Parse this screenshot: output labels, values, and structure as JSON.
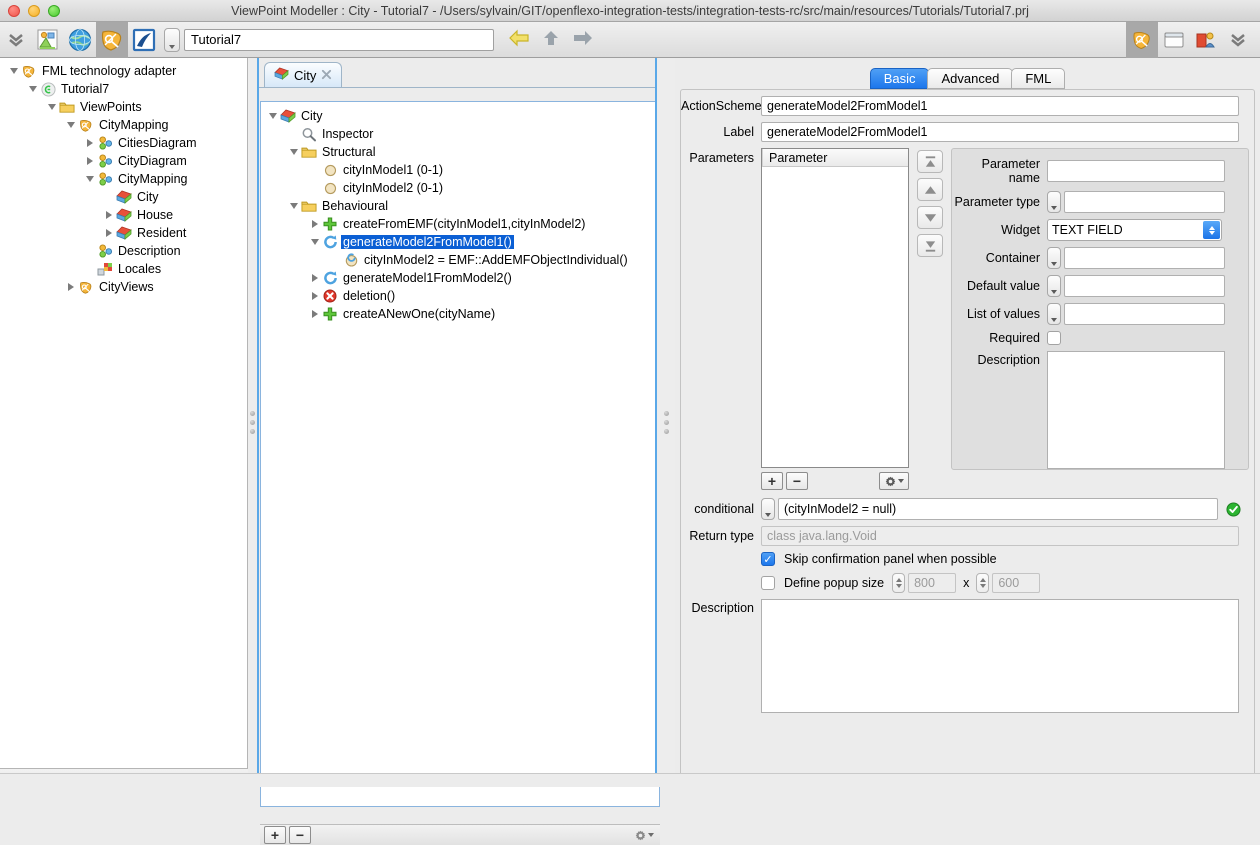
{
  "window": {
    "title": "ViewPoint Modeller : City - Tutorial7 - /Users/sylvain/GIT/openflexo-integration-tests/integration-tests-rc/src/main/resources/Tutorials/Tutorial7.prj"
  },
  "toolbar": {
    "icons": [
      "chevrons-down-icon",
      "diagram-image-icon",
      "globe-icon",
      "fml-shield-icon",
      "editor-pen-icon"
    ],
    "path_value": "Tutorial7",
    "nav": [
      "back-arrow-icon",
      "up-arrow-icon",
      "forward-arrow-icon"
    ],
    "right_icons": [
      "fml-shield-icon",
      "window-icon",
      "perspective-icon",
      "chevrons-down-icon"
    ]
  },
  "sidebar": {
    "items": [
      {
        "label": "FML technology adapter",
        "depth": 0,
        "twisty": "open",
        "icon": "fml-shield-icon"
      },
      {
        "label": "Tutorial7",
        "depth": 1,
        "twisty": "open",
        "icon": "project-icon"
      },
      {
        "label": "ViewPoints",
        "depth": 2,
        "twisty": "open",
        "icon": "folder-icon"
      },
      {
        "label": "CityMapping",
        "depth": 3,
        "twisty": "open",
        "icon": "fml-shield-icon"
      },
      {
        "label": "CitiesDiagram",
        "depth": 4,
        "twisty": "closed",
        "icon": "virtualmodel-icon"
      },
      {
        "label": "CityDiagram",
        "depth": 4,
        "twisty": "closed",
        "icon": "virtualmodel-icon"
      },
      {
        "label": "CityMapping",
        "depth": 4,
        "twisty": "open",
        "icon": "virtualmodel-icon"
      },
      {
        "label": "City",
        "depth": 5,
        "twisty": "none",
        "icon": "flexoconcept-icon"
      },
      {
        "label": "House",
        "depth": 5,
        "twisty": "closed",
        "icon": "flexoconcept-icon"
      },
      {
        "label": "Resident",
        "depth": 5,
        "twisty": "closed",
        "icon": "flexoconcept-icon"
      },
      {
        "label": "Description",
        "depth": 4,
        "twisty": "none",
        "icon": "virtualmodel-icon"
      },
      {
        "label": "Locales",
        "depth": 4,
        "twisty": "none",
        "icon": "locales-icon"
      },
      {
        "label": "CityViews",
        "depth": 3,
        "twisty": "closed",
        "icon": "fml-shield-icon"
      }
    ],
    "bottom_bar": {
      "add": "+",
      "remove": "−",
      "gear": "gear-icon"
    }
  },
  "center": {
    "tab": {
      "label": "City",
      "icon": "flexoconcept-icon",
      "close": "close-icon"
    },
    "tree": [
      {
        "label": "City",
        "depth": 0,
        "twisty": "open",
        "icon": "flexoconcept-icon",
        "selected": false
      },
      {
        "label": "Inspector",
        "depth": 1,
        "twisty": "none",
        "icon": "inspector-icon",
        "selected": false
      },
      {
        "label": "Structural",
        "depth": 1,
        "twisty": "open",
        "icon": "folder-icon",
        "selected": false
      },
      {
        "label": "cityInModel1 (0-1)",
        "depth": 2,
        "twisty": "none",
        "icon": "role-icon",
        "selected": false
      },
      {
        "label": "cityInModel2 (0-1)",
        "depth": 2,
        "twisty": "none",
        "icon": "role-icon",
        "selected": false
      },
      {
        "label": "Behavioural",
        "depth": 1,
        "twisty": "open",
        "icon": "folder-icon",
        "selected": false
      },
      {
        "label": "createFromEMF(cityInModel1,cityInModel2)",
        "depth": 2,
        "twisty": "closed",
        "icon": "creation-plus-icon",
        "selected": false
      },
      {
        "label": "generateModel2FromModel1()",
        "depth": 2,
        "twisty": "open",
        "icon": "action-scheme-icon",
        "selected": true
      },
      {
        "label": "cityInModel2 = EMF::AddEMFObjectIndividual()",
        "depth": 3,
        "twisty": "none",
        "icon": "edition-action-icon",
        "selected": false
      },
      {
        "label": "generateModel1FromModel2()",
        "depth": 2,
        "twisty": "closed",
        "icon": "action-scheme-icon",
        "selected": false
      },
      {
        "label": "deletion()",
        "depth": 2,
        "twisty": "closed",
        "icon": "deletion-icon",
        "selected": false
      },
      {
        "label": "createANewOne(cityName)",
        "depth": 2,
        "twisty": "closed",
        "icon": "creation-plus-icon",
        "selected": false
      }
    ],
    "bottom_bar": {
      "add": "+",
      "remove": "−",
      "gear": "gear-icon"
    }
  },
  "inspector": {
    "tabs": [
      {
        "label": "Basic",
        "active": true
      },
      {
        "label": "Advanced",
        "active": false
      },
      {
        "label": "FML",
        "active": false
      }
    ],
    "action_scheme": {
      "label": "ActionScheme",
      "value": "generateModel2FromModel1"
    },
    "label_field": {
      "label": "Label",
      "value": "generateModel2FromModel1"
    },
    "parameters": {
      "label": "Parameters",
      "column_header": "Parameter",
      "rows": [],
      "buttons": {
        "add": "+",
        "remove": "−",
        "gear": "gear-icon"
      },
      "reorder": [
        "move-to-top-icon",
        "move-up-icon",
        "move-down-icon",
        "move-to-bottom-icon"
      ]
    },
    "parameter_detail": {
      "name": {
        "label": "Parameter name",
        "value": ""
      },
      "type": {
        "label": "Parameter type",
        "value": ""
      },
      "widget": {
        "label": "Widget",
        "value": "TEXT FIELD"
      },
      "container": {
        "label": "Container",
        "value": ""
      },
      "default_value": {
        "label": "Default value",
        "value": ""
      },
      "list_of_values": {
        "label": "List of values",
        "value": ""
      },
      "required": {
        "label": "Required",
        "checked": false
      },
      "description": {
        "label": "Description",
        "value": ""
      }
    },
    "conditional": {
      "label": "conditional",
      "value": "(cityInModel2 = null)",
      "status_icon": "valid-check-icon"
    },
    "return_type": {
      "label": "Return type",
      "value": "class java.lang.Void",
      "readonly": true
    },
    "skip_confirmation": {
      "label": "Skip confirmation panel when possible",
      "checked": true
    },
    "popup_size": {
      "label": "Define popup size",
      "checked": false,
      "width": "800",
      "separator": "x",
      "height": "600"
    },
    "description": {
      "label": "Description",
      "value": ""
    }
  },
  "colors": {
    "accent": "#1d77ec",
    "selection": "#0b5fd4",
    "splitter": "#5aa8e8",
    "valid_green": "#2cb431"
  }
}
